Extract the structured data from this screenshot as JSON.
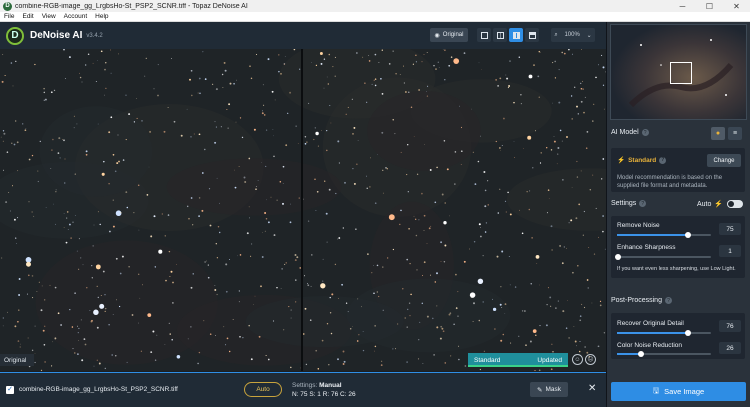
{
  "window": {
    "title": "combine-RGB-image_gg_LrgbsHo-St_PSP2_SCNR.tiff - Topaz DeNoise AI",
    "controls": [
      "─",
      "☐",
      "✕"
    ]
  },
  "menu": [
    "File",
    "Edit",
    "View",
    "Account",
    "Help"
  ],
  "toolbar": {
    "brand": "DeNoise AI",
    "version": "v3.4.2",
    "original_label": "Original",
    "zoom": "100%"
  },
  "viewer": {
    "original_label": "Original",
    "status_left": "Standard",
    "status_right": "Updated",
    "progress": 1.0
  },
  "filebar": {
    "filename": "combine-RGB-image_gg_LrgbsHo-St_PSP2_SCNR.tiff",
    "auto_label": "Auto",
    "settings_prefix": "Settings:",
    "settings_mode": "Manual",
    "params_line": "N: 75  S: 1  R: 76  C: 26",
    "mask_label": "Mask",
    "close": "✕"
  },
  "panel": {
    "ai_model": {
      "title": "AI Model",
      "model": "Standard",
      "change_label": "Change",
      "description": "Model recommendation is based on the supplied file format and metadata."
    },
    "settings": {
      "title": "Settings",
      "auto_label": "Auto",
      "remove_noise": {
        "label": "Remove Noise",
        "value": "75",
        "fraction": 0.75
      },
      "enhance_sharpness": {
        "label": "Enhance Sharpness",
        "value": "1",
        "fraction": 0.01
      },
      "hint": "If you want even less sharpening, use Low Light."
    },
    "post_processing": {
      "title": "Post-Processing",
      "recover_detail": {
        "label": "Recover Original Detail",
        "value": "76",
        "fraction": 0.76
      },
      "color_noise": {
        "label": "Color Noise Reduction",
        "value": "26",
        "fraction": 0.26
      }
    },
    "save_label": "Save Image"
  },
  "colors": {
    "accent": "#2e8de4",
    "status": "#1f8f9c",
    "gold": "#e8b23a"
  }
}
